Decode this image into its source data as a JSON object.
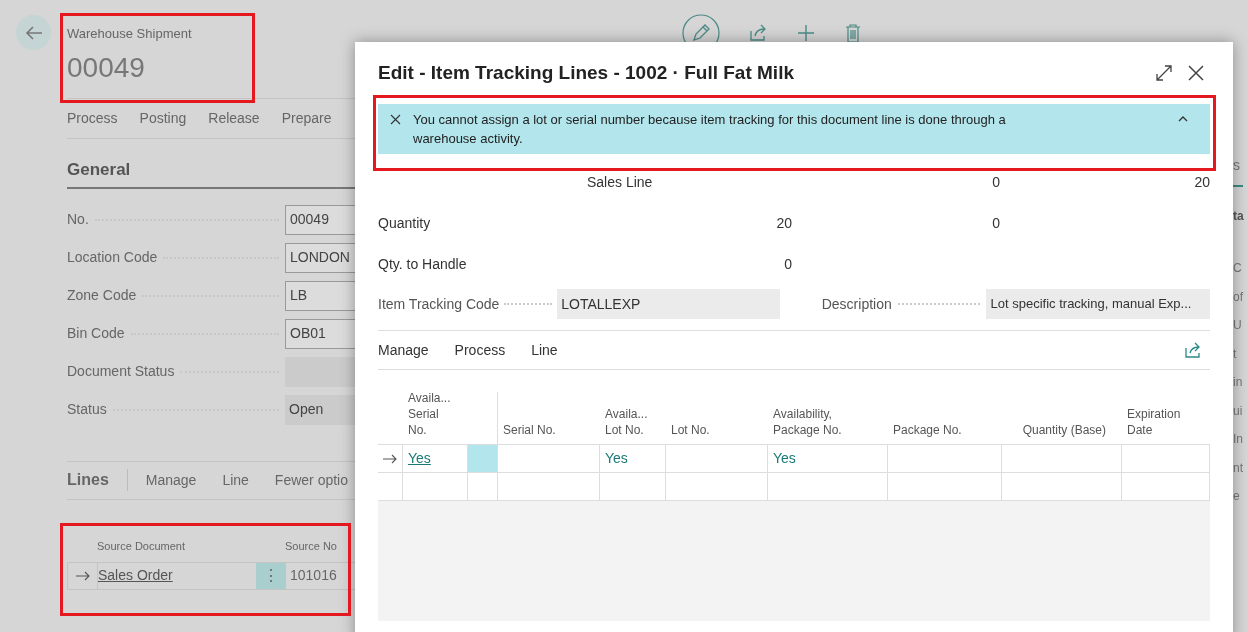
{
  "page": {
    "caption": "Warehouse Shipment",
    "number": "00049",
    "actions": [
      "Process",
      "Posting",
      "Release",
      "Prepare"
    ],
    "section_title": "General",
    "fields": [
      {
        "label": "No.",
        "value": "00049",
        "editable": true
      },
      {
        "label": "Location Code",
        "value": "LONDON",
        "editable": true
      },
      {
        "label": "Zone Code",
        "value": "LB",
        "editable": true
      },
      {
        "label": "Bin Code",
        "value": "OB01",
        "editable": true
      },
      {
        "label": "Document Status",
        "editable": false
      },
      {
        "label": "Status",
        "value": "Open",
        "editable": false
      }
    ],
    "lines": {
      "title": "Lines",
      "actions": [
        "Manage",
        "Line",
        "Fewer optio"
      ],
      "columns": [
        "Source Document",
        "Source No"
      ],
      "rows": [
        {
          "selected": true,
          "source_document": "Sales Order",
          "source_no": "101016",
          "row_menu": "⋮"
        }
      ]
    },
    "right_panel_fragments": [
      {
        "text": "s",
        "kind": "tab"
      },
      {
        "text": "ta",
        "kind": "heading"
      },
      {
        "text": "C",
        "kind": "field"
      },
      {
        "text": "of",
        "kind": "field"
      },
      {
        "text": "U",
        "kind": "field"
      },
      {
        "text": "t",
        "kind": "field"
      },
      {
        "text": "in",
        "kind": "field"
      },
      {
        "text": "ui",
        "kind": "field"
      },
      {
        "text": "In",
        "kind": "field"
      },
      {
        "text": "nt",
        "kind": "field"
      },
      {
        "text": "e",
        "kind": "field"
      }
    ]
  },
  "dialog": {
    "title": "Edit - Item Tracking Lines - 1002 · Full Fat Milk",
    "notification": "You cannot assign a lot or serial number because item tracking for this document line is done through a warehouse activity.",
    "summary": [
      {
        "kind": "source",
        "cells": [
          "Sales Line",
          "0",
          "20"
        ]
      },
      {
        "kind": "quantity",
        "label": "Quantity",
        "cells": [
          "20",
          "0",
          ""
        ]
      },
      {
        "kind": "quantity",
        "label": "Qty. to Handle",
        "cells": [
          "0",
          "",
          ""
        ]
      }
    ],
    "item_tracking_code": {
      "label": "Item Tracking Code",
      "value": "LOTALLEXP"
    },
    "description": {
      "label": "Description",
      "value": "Lot specific tracking, manual Exp..."
    },
    "actions": [
      "Manage",
      "Process",
      "Line"
    ],
    "table": {
      "columns": [
        "Availa...\nSerial\nNo.",
        "Serial No.",
        "Availa...\nLot No.",
        "Lot No.",
        "Availability,\nPackage No.",
        "Package No.",
        "Quantity (Base)",
        "Expiration\nDate"
      ],
      "rows": [
        {
          "selected": true,
          "cells": [
            "Yes",
            "",
            "Yes",
            "",
            "Yes",
            "",
            "",
            ""
          ]
        },
        {
          "selected": false,
          "cells": [
            "",
            "",
            "",
            "",
            "",
            "",
            "",
            ""
          ]
        }
      ]
    }
  }
}
